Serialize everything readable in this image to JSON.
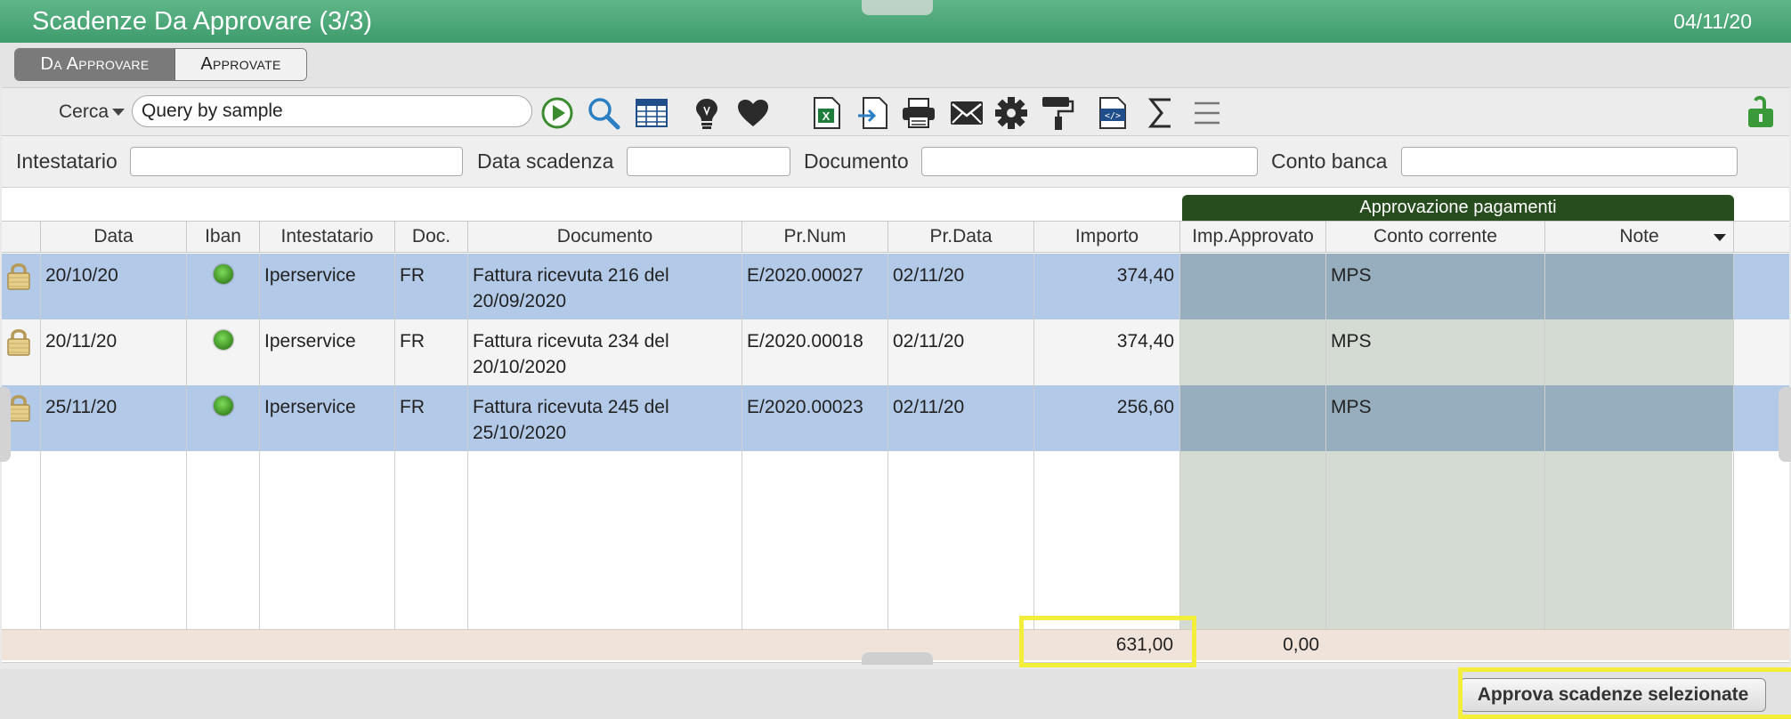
{
  "window": {
    "title": "Scadenze Da Approvare (3/3)",
    "date": "04/11/20"
  },
  "tabs": [
    {
      "label": "Da Approvare",
      "active": true
    },
    {
      "label": "Approvate",
      "active": false
    }
  ],
  "toolbar": {
    "search_label": "Cerca",
    "search_value": "Query by sample",
    "icons": [
      "play-icon",
      "search-icon",
      "table-icon",
      "lightbulb-icon",
      "heart-icon",
      "excel-icon",
      "import-icon",
      "print-icon",
      "mail-icon",
      "gear-icon",
      "paint-roller-icon",
      "code-doc-icon",
      "sigma-icon",
      "menu-icon",
      "unlock-icon"
    ]
  },
  "filters": [
    {
      "label": "Intestatario",
      "value": ""
    },
    {
      "label": "Data scadenza",
      "value": ""
    },
    {
      "label": "Documento",
      "value": ""
    },
    {
      "label": "Conto banca",
      "value": ""
    }
  ],
  "grid": {
    "group_header": "Approvazione pagamenti",
    "columns": [
      "Data",
      "Iban",
      "Intestatario",
      "Doc.",
      "Documento",
      "Pr.Num",
      "Pr.Data",
      "Importo",
      "Imp.Approvato",
      "Conto corrente",
      "Note"
    ],
    "rows": [
      {
        "data": "20/10/20",
        "intestatario": "Iperservice",
        "doc": "FR",
        "documento": "Fattura ricevuta 216 del 20/09/2020",
        "prnum": "E/2020.00027",
        "prdata": "02/11/20",
        "importo": "374,40",
        "imp_approvato": "",
        "conto": "MPS",
        "note": "",
        "selected": true
      },
      {
        "data": "20/11/20",
        "intestatario": "Iperservice",
        "doc": "FR",
        "documento": "Fattura ricevuta 234 del 20/10/2020",
        "prnum": "E/2020.00018",
        "prdata": "02/11/20",
        "importo": "374,40",
        "imp_approvato": "",
        "conto": "MPS",
        "note": "",
        "selected": false
      },
      {
        "data": "25/11/20",
        "intestatario": "Iperservice",
        "doc": "FR",
        "documento": "Fattura ricevuta 245 del 25/10/2020",
        "prnum": "E/2020.00023",
        "prdata": "02/11/20",
        "importo": "256,60",
        "imp_approvato": "",
        "conto": "MPS",
        "note": "",
        "selected": true
      }
    ],
    "totals": {
      "importo": "631,00",
      "imp_approvato": "0,00"
    }
  },
  "actions": {
    "approve_label": "Approva scadenze selezionate"
  },
  "colors": {
    "title_green": "#4aa677",
    "selected_row": "#b3c9e8",
    "group_header": "#274d1f",
    "highlight": "#f2ee3a"
  }
}
